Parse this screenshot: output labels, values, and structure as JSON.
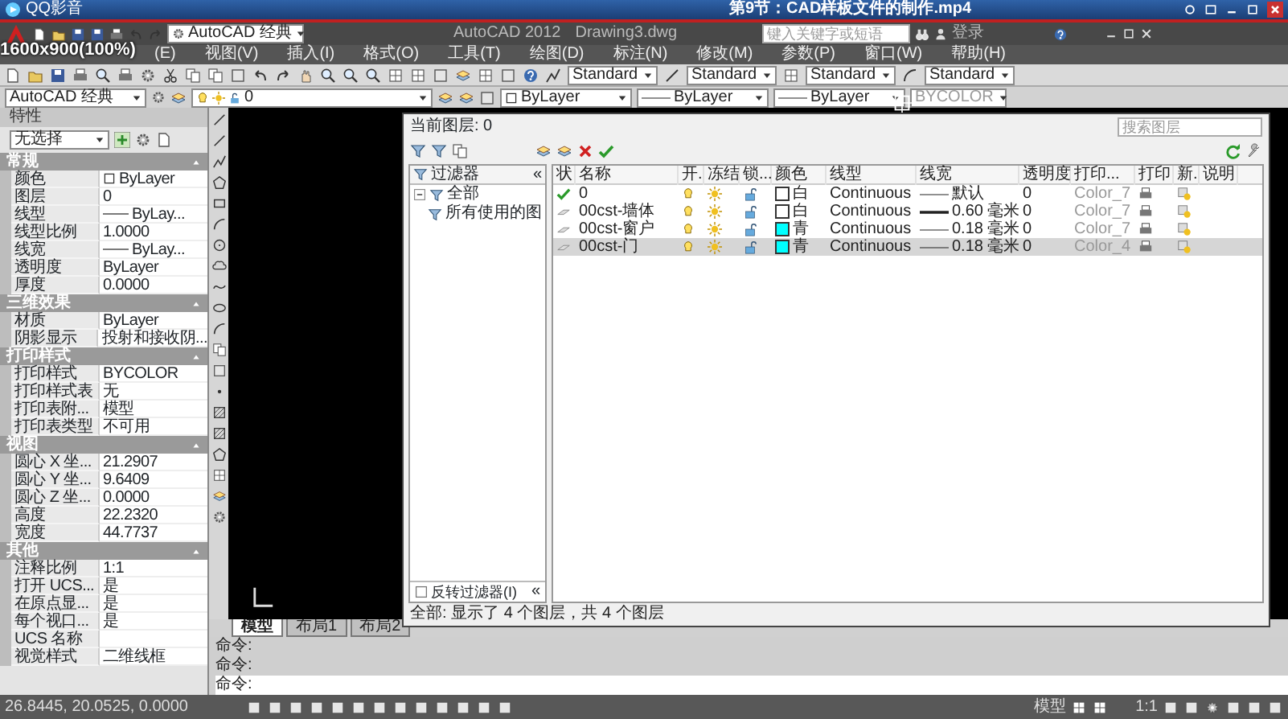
{
  "player": {
    "app_name": "QQ影音",
    "video_title": "第9节：CAD样板文件的制作.mp4",
    "video_overlay": "1600x900(100%)"
  },
  "title_bar": {
    "workspace": "AutoCAD 经典",
    "app_title": "AutoCAD 2012",
    "file_name": "Drawing3.dwg",
    "search": {
      "placeholder": "键入关键字或短语"
    },
    "sign_in": "登录"
  },
  "menu": [
    "(E)",
    "视图(V)",
    "插入(I)",
    "格式(O)",
    "工具(T)",
    "绘图(D)",
    "标注(N)",
    "修改(M)",
    "参数(P)",
    "窗口(W)",
    "帮助(H)"
  ],
  "style_toolbar": {
    "text_style": "Standard",
    "dim_style": "Standard",
    "table_style": "Standard",
    "multileader_style": "Standard"
  },
  "layers_toolbar": {
    "workspace": "AutoCAD 经典",
    "layer": "0",
    "color_value": "ByLayer",
    "linetype": "ByLayer",
    "lineweight": "ByLayer",
    "plot_style": "BYCOLOR"
  },
  "properties": {
    "title": "特性",
    "selection": "无选择",
    "sections": [
      {
        "title": "常规",
        "rows": [
          {
            "label": "颜色",
            "value": "ByLayer",
            "kind": "color"
          },
          {
            "label": "图层",
            "value": "0",
            "kind": "text"
          },
          {
            "label": "线型",
            "value": "ByLay...",
            "kind": "line"
          },
          {
            "label": "线型比例",
            "value": "1.0000",
            "kind": "text"
          },
          {
            "label": "线宽",
            "value": "ByLay...",
            "kind": "line"
          },
          {
            "label": "透明度",
            "value": "ByLayer",
            "kind": "text"
          },
          {
            "label": "厚度",
            "value": "0.0000",
            "kind": "text"
          }
        ]
      },
      {
        "title": "三维效果",
        "rows": [
          {
            "label": "材质",
            "value": "ByLayer",
            "kind": "text"
          },
          {
            "label": "阴影显示",
            "value": "投射和接收阴...",
            "kind": "text"
          }
        ]
      },
      {
        "title": "打印样式",
        "rows": [
          {
            "label": "打印样式",
            "value": "BYCOLOR",
            "kind": "text"
          },
          {
            "label": "打印样式表",
            "value": "无",
            "kind": "text"
          },
          {
            "label": "打印表附...",
            "value": "模型",
            "kind": "text"
          },
          {
            "label": "打印表类型",
            "value": "不可用",
            "kind": "text"
          }
        ]
      },
      {
        "title": "视图",
        "rows": [
          {
            "label": "圆心 X 坐...",
            "value": "21.2907",
            "kind": "text"
          },
          {
            "label": "圆心 Y 坐...",
            "value": "9.6409",
            "kind": "text"
          },
          {
            "label": "圆心 Z 坐...",
            "value": "0.0000",
            "kind": "text"
          },
          {
            "label": "高度",
            "value": "22.2320",
            "kind": "text"
          },
          {
            "label": "宽度",
            "value": "44.7737",
            "kind": "text"
          }
        ]
      },
      {
        "title": "其他",
        "rows": [
          {
            "label": "注释比例",
            "value": "1:1",
            "kind": "text"
          },
          {
            "label": "打开 UCS...",
            "value": "是",
            "kind": "text"
          },
          {
            "label": "在原点显...",
            "value": "是",
            "kind": "text"
          },
          {
            "label": "每个视口...",
            "value": "是",
            "kind": "text"
          },
          {
            "label": "UCS 名称",
            "kind": "text"
          },
          {
            "label": "视觉样式",
            "value": "二维线框",
            "kind": "text"
          }
        ]
      }
    ]
  },
  "layer_manager": {
    "current_layer": "当前图层: 0",
    "search": {
      "placeholder": "搜索图层"
    },
    "filter_tree": {
      "header": "过滤器",
      "collapse": "«",
      "items": [
        {
          "label": "全部",
          "expanded": true,
          "children": [
            {
              "label": "所有使用的图"
            }
          ]
        }
      ]
    },
    "invert_filter": {
      "label": "反转过滤器(I)",
      "checked": false,
      "collapse": "«"
    },
    "columns": [
      "状",
      "名称",
      "开.",
      "冻结",
      "锁...",
      "颜色",
      "线型",
      "线宽",
      "透明度",
      "打印...",
      "打印",
      "新.",
      "说明"
    ],
    "layers": [
      {
        "current": true,
        "name": "0",
        "on": true,
        "frozen": false,
        "locked": false,
        "color": "#ffffff",
        "color_name": "白",
        "linetype": "Continuous",
        "thick": false,
        "lineweight": "默认",
        "transparency": "0",
        "plot_style": "Color_7",
        "plot": true,
        "selected": false
      },
      {
        "current": false,
        "name": "00cst-墙体",
        "on": true,
        "frozen": false,
        "locked": false,
        "color": "#ffffff",
        "color_name": "白",
        "linetype": "Continuous",
        "thick": true,
        "lineweight": "0.60 毫米",
        "transparency": "0",
        "plot_style": "Color_7",
        "plot": true,
        "selected": false
      },
      {
        "current": false,
        "name": "00cst-窗户",
        "on": true,
        "frozen": false,
        "locked": false,
        "color": "#00ffff",
        "color_name": "青",
        "linetype": "Continuous",
        "thick": false,
        "lineweight": "0.18 毫米",
        "transparency": "0",
        "plot_style": "Color_7",
        "plot": true,
        "selected": false
      },
      {
        "current": false,
        "name": "00cst-门",
        "on": true,
        "frozen": false,
        "locked": false,
        "color": "#00ffff",
        "color_name": "青",
        "linetype": "Continuous",
        "thick": false,
        "lineweight": "0.18 毫米",
        "transparency": "0",
        "plot_style": "Color_4",
        "plot": true,
        "selected": true
      }
    ],
    "summary": "全部: 显示了 4 个图层，共 4 个图层"
  },
  "layout_tabs": [
    {
      "label": "模型",
      "selected": true
    },
    {
      "label": "布局1",
      "selected": false
    },
    {
      "label": "布局2",
      "selected": false
    }
  ],
  "command_lines": [
    "命令:",
    "命令:",
    "命令:"
  ],
  "status_bar": {
    "coordinates": "26.8445, 20.0525, 0.0000",
    "model": "模型",
    "scale": "1:1"
  }
}
